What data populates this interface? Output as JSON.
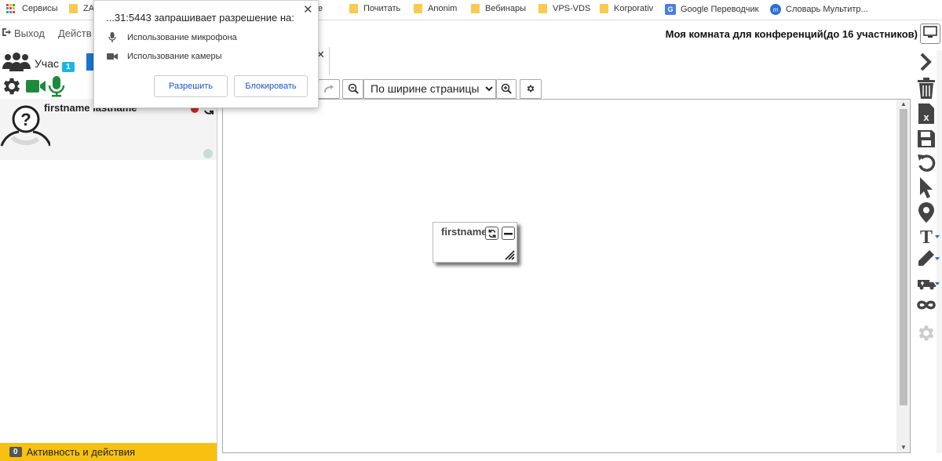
{
  "bookmarks": {
    "items": [
      {
        "label": "Сервисы",
        "icon": "apps-grid-icon"
      },
      {
        "label": "ZA",
        "icon": "folder-icon"
      },
      {
        "label": "кное",
        "icon": "folder-icon"
      },
      {
        "label": "Почитать",
        "icon": "folder-icon"
      },
      {
        "label": "Anonim",
        "icon": "folder-icon"
      },
      {
        "label": "Вебинары",
        "icon": "folder-icon"
      },
      {
        "label": "VPS-VDS",
        "icon": "folder-icon"
      },
      {
        "label": "Korporativ",
        "icon": "folder-icon"
      },
      {
        "label": "Google Переводчик",
        "icon": "google-translate-icon"
      },
      {
        "label": "Словарь Мультитр...",
        "icon": "multitran-icon"
      }
    ]
  },
  "menubar": {
    "exit_label": "Выход",
    "actions_label": "Действ",
    "room_title": "Моя комната для конференций(до 16 участников)"
  },
  "left": {
    "users_tab_label": "Учас",
    "users_count": "1",
    "user_name": "firstname lastname",
    "activity_count": "0",
    "activity_label": "Активность и действия"
  },
  "whiteboard": {
    "zoom_value": "По ширине страницы",
    "zoom_options": [
      "По ширине страницы"
    ],
    "pod_name": "firstname lastname"
  },
  "permission": {
    "title": "...31:5443 запрашивает разрешение на:",
    "mic_label": "Использование микрофона",
    "camera_label": "Использование камеры",
    "allow_label": "Разрешить",
    "block_label": "Блокировать"
  },
  "colors": {
    "accent_blue": "#1976d2",
    "badge_cyan": "#1ab5e7",
    "activity_yellow": "#f8c111",
    "status_red": "#d3252a",
    "green": "#1e8a3c"
  }
}
